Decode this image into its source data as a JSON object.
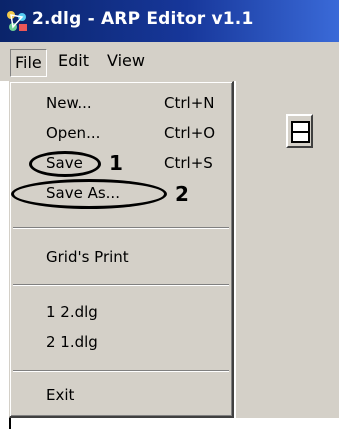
{
  "window": {
    "title": "2.dlg - ARP Editor v1.1",
    "app_icon": "arp-editor-icon"
  },
  "menubar": {
    "items": [
      {
        "label": "File"
      },
      {
        "label": "Edit"
      },
      {
        "label": "View"
      }
    ]
  },
  "file_menu": {
    "items": [
      {
        "label": "New...",
        "accel": "Ctrl+N"
      },
      {
        "label": "Open...",
        "accel": "Ctrl+O"
      },
      {
        "label": "Save",
        "accel": "Ctrl+S"
      },
      {
        "label": "Save As...",
        "accel": ""
      },
      {
        "label": "Grid's Print",
        "accel": ""
      },
      {
        "label": "1 2.dlg",
        "accel": ""
      },
      {
        "label": "2 1.dlg",
        "accel": ""
      },
      {
        "label": "Exit",
        "accel": ""
      }
    ]
  },
  "callouts": [
    {
      "number": "1",
      "target": "Save"
    },
    {
      "number": "2",
      "target": "Save As..."
    }
  ],
  "toolbar": {
    "button_icon": "window-layout-icon"
  },
  "colors": {
    "titlebar_start": "#0a246a",
    "titlebar_end": "#3a6ad8",
    "face": "#d4d0c8"
  }
}
